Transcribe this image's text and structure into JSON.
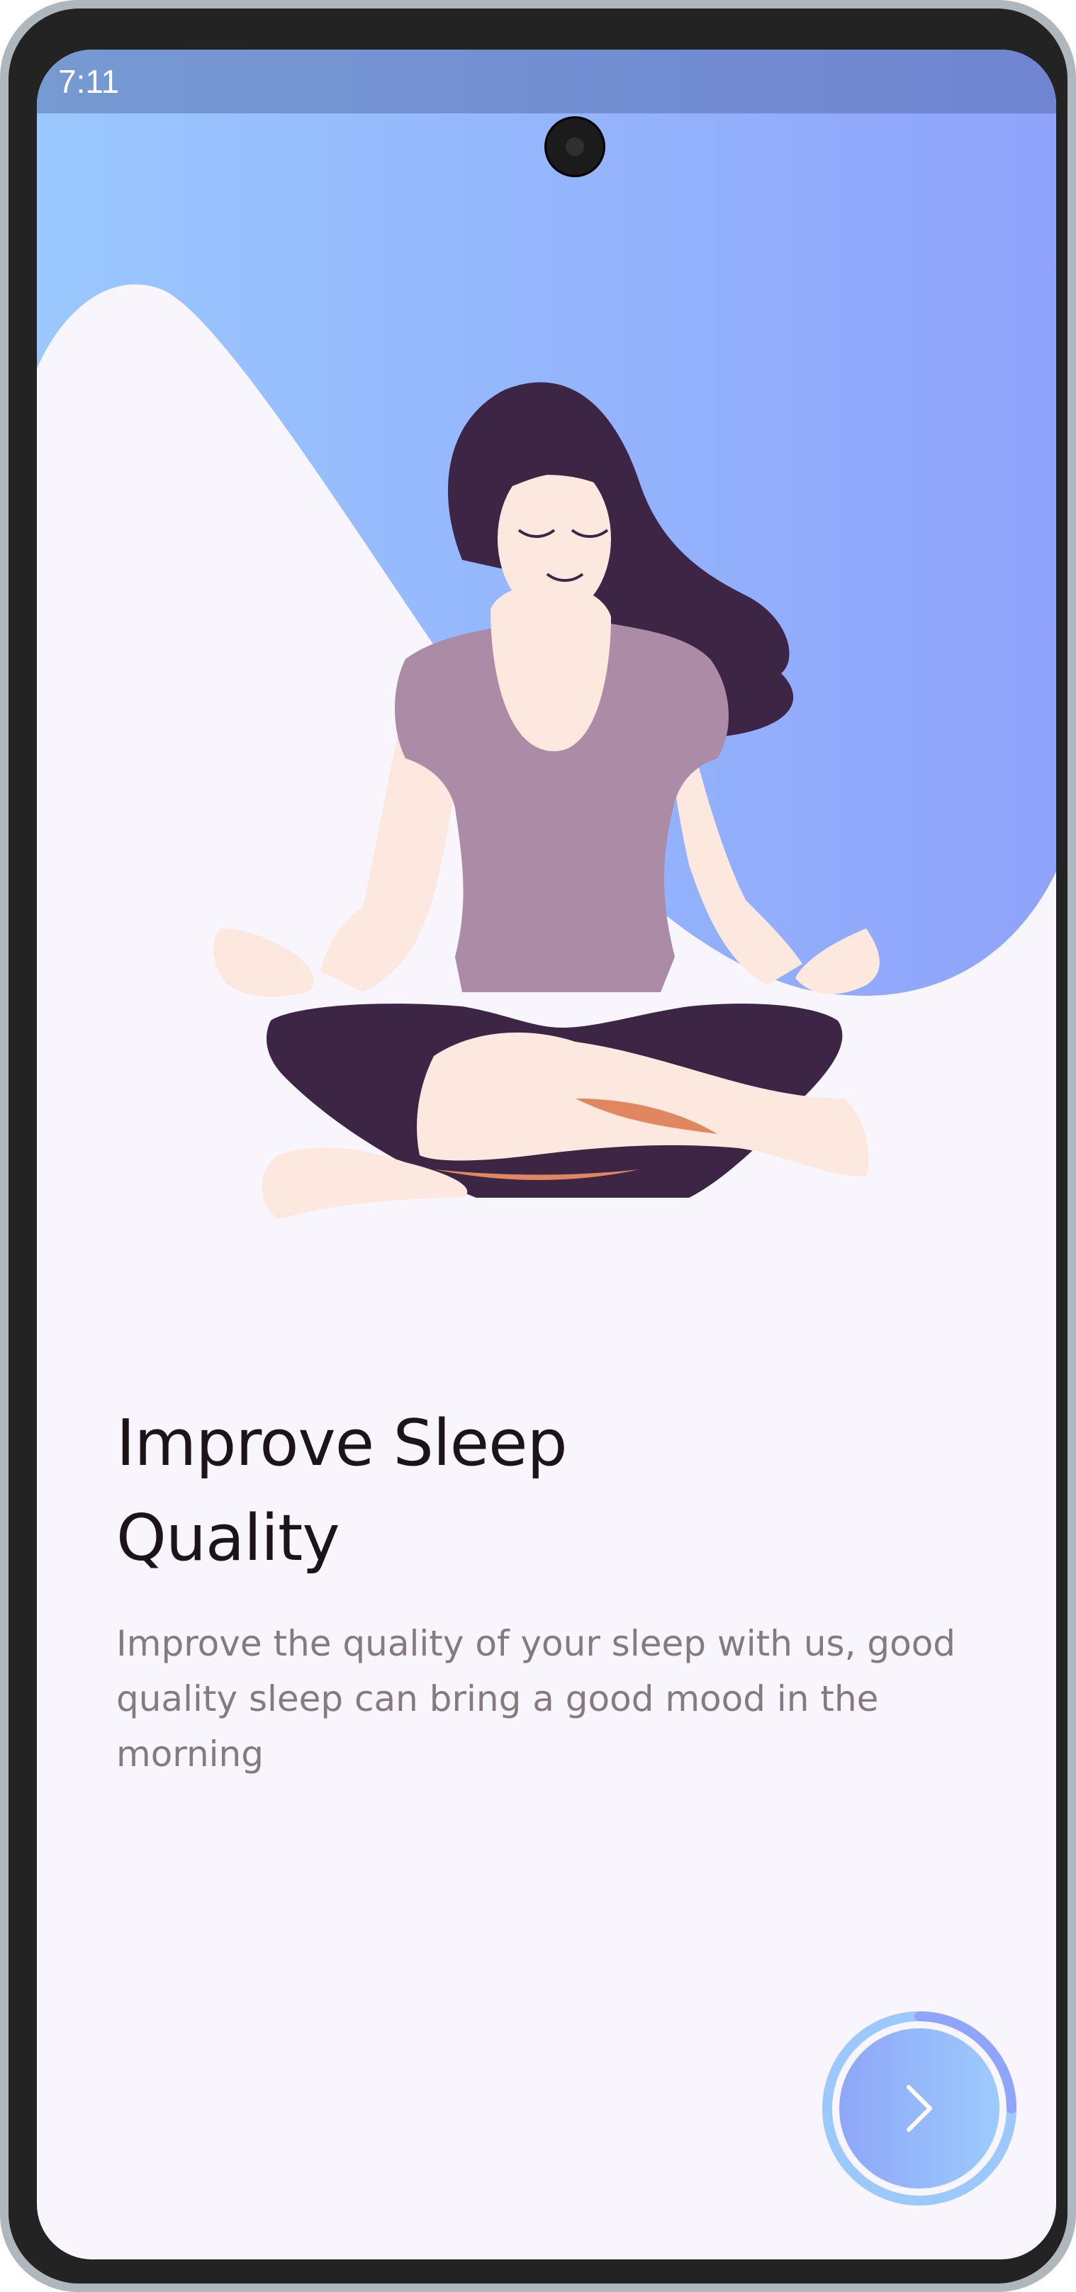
{
  "status_bar": {
    "time": "7:11"
  },
  "onboarding": {
    "title_line1": "Improve Sleep",
    "title_line2": "Quality",
    "description": "Improve the quality of your sleep with us, good quality sleep can bring a good mood in the morning"
  },
  "colors": {
    "hero_gradient_start": "#9ac8fe",
    "hero_gradient_end": "#8fa3fb",
    "background": "#f8f5fd",
    "title": "#1c1418",
    "body_text": "#857a7d"
  },
  "icons": {
    "next": "chevron-right-icon"
  }
}
